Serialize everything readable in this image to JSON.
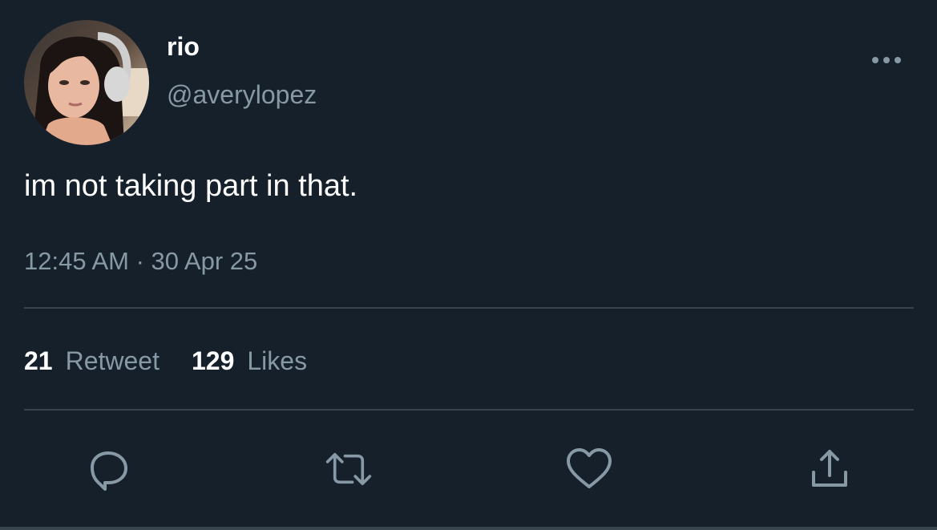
{
  "tweet": {
    "display_name": "rio",
    "handle": "@averylopez",
    "text": "im not taking part in that.",
    "timestamp": "12:45 AM · 30 Apr 25"
  },
  "stats": {
    "retweets_count": "21",
    "retweets_label": "Retweet",
    "likes_count": "129",
    "likes_label": "Likes"
  },
  "icons": {
    "more": "more-horizontal-icon",
    "reply": "reply-bubble-icon",
    "retweet": "retweet-arrows-icon",
    "like": "heart-icon",
    "share": "share-upload-icon"
  },
  "colors": {
    "background": "#15202b",
    "primary_text": "#ffffff",
    "secondary_text": "#8899a6",
    "divider": "#38444d"
  }
}
